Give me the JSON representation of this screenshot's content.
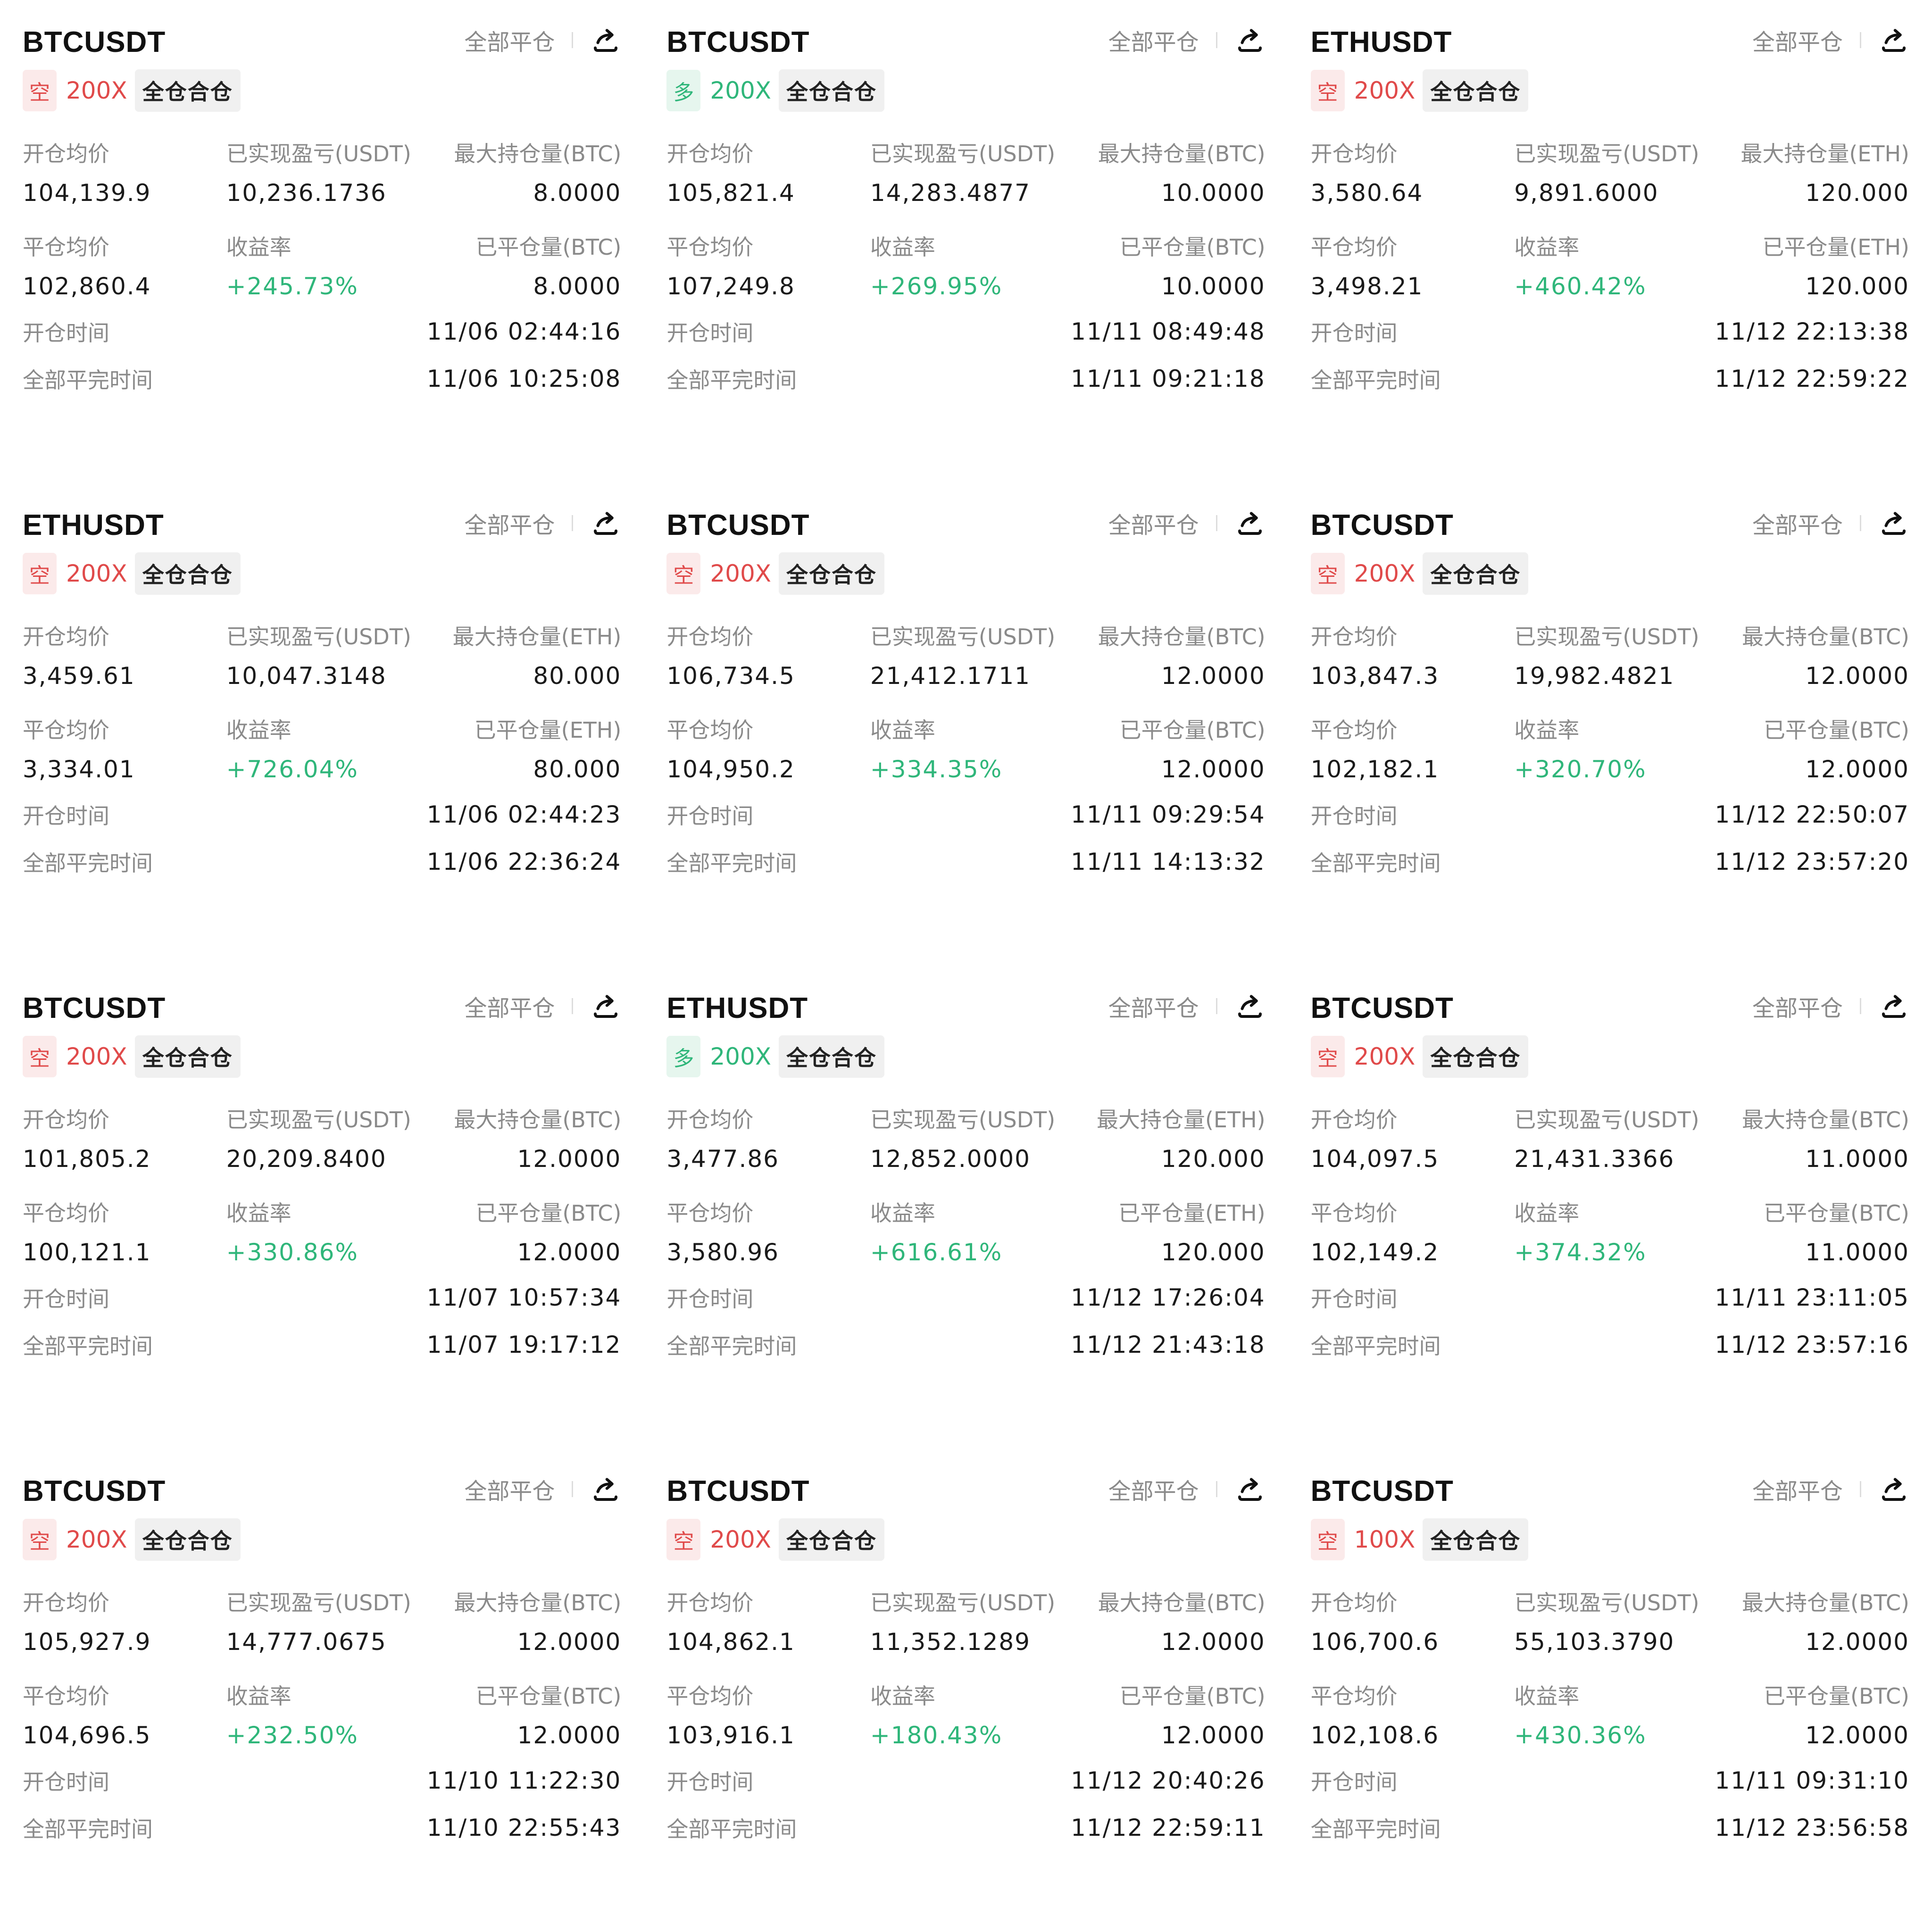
{
  "colors": {
    "short_red": "#e04a4a",
    "short_bg": "#fbeaea",
    "long_green": "#2fb67a",
    "long_bg": "#e6f6ee",
    "profit_green": "#2fb67a"
  },
  "cards": [
    {
      "symbol": "BTCUSDT",
      "close_all": "全部平仓",
      "side": "空",
      "side_type": "short",
      "leverage": "200X",
      "mode": "全仓合仓",
      "open_avg_label": "开仓均价",
      "open_avg": "104,139.9",
      "pnl_label": "已实现盈亏(USDT)",
      "pnl": "10,236.1736",
      "max_pos_label": "最大持仓量(BTC)",
      "max_pos": "8.0000",
      "close_avg_label": "平仓均价",
      "close_avg": "102,860.4",
      "roi_label": "收益率",
      "roi": "+245.73%",
      "closed_qty_label": "已平仓量(BTC)",
      "closed_qty": "8.0000",
      "open_time_label": "开仓时间",
      "open_time": "11/06 02:44:16",
      "close_time_label": "全部平完时间",
      "close_time": "11/06 10:25:08"
    },
    {
      "symbol": "BTCUSDT",
      "close_all": "全部平仓",
      "side": "多",
      "side_type": "long",
      "leverage": "200X",
      "mode": "全仓合仓",
      "open_avg_label": "开仓均价",
      "open_avg": "105,821.4",
      "pnl_label": "已实现盈亏(USDT)",
      "pnl": "14,283.4877",
      "max_pos_label": "最大持仓量(BTC)",
      "max_pos": "10.0000",
      "close_avg_label": "平仓均价",
      "close_avg": "107,249.8",
      "roi_label": "收益率",
      "roi": "+269.95%",
      "closed_qty_label": "已平仓量(BTC)",
      "closed_qty": "10.0000",
      "open_time_label": "开仓时间",
      "open_time": "11/11 08:49:48",
      "close_time_label": "全部平完时间",
      "close_time": "11/11 09:21:18"
    },
    {
      "symbol": "ETHUSDT",
      "close_all": "全部平仓",
      "side": "空",
      "side_type": "short",
      "leverage": "200X",
      "mode": "全仓合仓",
      "open_avg_label": "开仓均价",
      "open_avg": "3,580.64",
      "pnl_label": "已实现盈亏(USDT)",
      "pnl": "9,891.6000",
      "max_pos_label": "最大持仓量(ETH)",
      "max_pos": "120.000",
      "close_avg_label": "平仓均价",
      "close_avg": "3,498.21",
      "roi_label": "收益率",
      "roi": "+460.42%",
      "closed_qty_label": "已平仓量(ETH)",
      "closed_qty": "120.000",
      "open_time_label": "开仓时间",
      "open_time": "11/12 22:13:38",
      "close_time_label": "全部平完时间",
      "close_time": "11/12 22:59:22"
    },
    {
      "symbol": "ETHUSDT",
      "close_all": "全部平仓",
      "side": "空",
      "side_type": "short",
      "leverage": "200X",
      "mode": "全仓合仓",
      "open_avg_label": "开仓均价",
      "open_avg": "3,459.61",
      "pnl_label": "已实现盈亏(USDT)",
      "pnl": "10,047.3148",
      "max_pos_label": "最大持仓量(ETH)",
      "max_pos": "80.000",
      "close_avg_label": "平仓均价",
      "close_avg": "3,334.01",
      "roi_label": "收益率",
      "roi": "+726.04%",
      "closed_qty_label": "已平仓量(ETH)",
      "closed_qty": "80.000",
      "open_time_label": "开仓时间",
      "open_time": "11/06 02:44:23",
      "close_time_label": "全部平完时间",
      "close_time": "11/06 22:36:24"
    },
    {
      "symbol": "BTCUSDT",
      "close_all": "全部平仓",
      "side": "空",
      "side_type": "short",
      "leverage": "200X",
      "mode": "全仓合仓",
      "open_avg_label": "开仓均价",
      "open_avg": "106,734.5",
      "pnl_label": "已实现盈亏(USDT)",
      "pnl": "21,412.1711",
      "max_pos_label": "最大持仓量(BTC)",
      "max_pos": "12.0000",
      "close_avg_label": "平仓均价",
      "close_avg": "104,950.2",
      "roi_label": "收益率",
      "roi": "+334.35%",
      "closed_qty_label": "已平仓量(BTC)",
      "closed_qty": "12.0000",
      "open_time_label": "开仓时间",
      "open_time": "11/11 09:29:54",
      "close_time_label": "全部平完时间",
      "close_time": "11/11 14:13:32"
    },
    {
      "symbol": "BTCUSDT",
      "close_all": "全部平仓",
      "side": "空",
      "side_type": "short",
      "leverage": "200X",
      "mode": "全仓合仓",
      "open_avg_label": "开仓均价",
      "open_avg": "103,847.3",
      "pnl_label": "已实现盈亏(USDT)",
      "pnl": "19,982.4821",
      "max_pos_label": "最大持仓量(BTC)",
      "max_pos": "12.0000",
      "close_avg_label": "平仓均价",
      "close_avg": "102,182.1",
      "roi_label": "收益率",
      "roi": "+320.70%",
      "closed_qty_label": "已平仓量(BTC)",
      "closed_qty": "12.0000",
      "open_time_label": "开仓时间",
      "open_time": "11/12 22:50:07",
      "close_time_label": "全部平完时间",
      "close_time": "11/12 23:57:20"
    },
    {
      "symbol": "BTCUSDT",
      "close_all": "全部平仓",
      "side": "空",
      "side_type": "short",
      "leverage": "200X",
      "mode": "全仓合仓",
      "open_avg_label": "开仓均价",
      "open_avg": "101,805.2",
      "pnl_label": "已实现盈亏(USDT)",
      "pnl": "20,209.8400",
      "max_pos_label": "最大持仓量(BTC)",
      "max_pos": "12.0000",
      "close_avg_label": "平仓均价",
      "close_avg": "100,121.1",
      "roi_label": "收益率",
      "roi": "+330.86%",
      "closed_qty_label": "已平仓量(BTC)",
      "closed_qty": "12.0000",
      "open_time_label": "开仓时间",
      "open_time": "11/07 10:57:34",
      "close_time_label": "全部平完时间",
      "close_time": "11/07 19:17:12"
    },
    {
      "symbol": "ETHUSDT",
      "close_all": "全部平仓",
      "side": "多",
      "side_type": "long",
      "leverage": "200X",
      "mode": "全仓合仓",
      "open_avg_label": "开仓均价",
      "open_avg": "3,477.86",
      "pnl_label": "已实现盈亏(USDT)",
      "pnl": "12,852.0000",
      "max_pos_label": "最大持仓量(ETH)",
      "max_pos": "120.000",
      "close_avg_label": "平仓均价",
      "close_avg": "3,580.96",
      "roi_label": "收益率",
      "roi": "+616.61%",
      "closed_qty_label": "已平仓量(ETH)",
      "closed_qty": "120.000",
      "open_time_label": "开仓时间",
      "open_time": "11/12 17:26:04",
      "close_time_label": "全部平完时间",
      "close_time": "11/12 21:43:18"
    },
    {
      "symbol": "BTCUSDT",
      "close_all": "全部平仓",
      "side": "空",
      "side_type": "short",
      "leverage": "200X",
      "mode": "全仓合仓",
      "open_avg_label": "开仓均价",
      "open_avg": "104,097.5",
      "pnl_label": "已实现盈亏(USDT)",
      "pnl": "21,431.3366",
      "max_pos_label": "最大持仓量(BTC)",
      "max_pos": "11.0000",
      "close_avg_label": "平仓均价",
      "close_avg": "102,149.2",
      "roi_label": "收益率",
      "roi": "+374.32%",
      "closed_qty_label": "已平仓量(BTC)",
      "closed_qty": "11.0000",
      "open_time_label": "开仓时间",
      "open_time": "11/11 23:11:05",
      "close_time_label": "全部平完时间",
      "close_time": "11/12 23:57:16"
    },
    {
      "symbol": "BTCUSDT",
      "close_all": "全部平仓",
      "side": "空",
      "side_type": "short",
      "leverage": "200X",
      "mode": "全仓合仓",
      "open_avg_label": "开仓均价",
      "open_avg": "105,927.9",
      "pnl_label": "已实现盈亏(USDT)",
      "pnl": "14,777.0675",
      "max_pos_label": "最大持仓量(BTC)",
      "max_pos": "12.0000",
      "close_avg_label": "平仓均价",
      "close_avg": "104,696.5",
      "roi_label": "收益率",
      "roi": "+232.50%",
      "closed_qty_label": "已平仓量(BTC)",
      "closed_qty": "12.0000",
      "open_time_label": "开仓时间",
      "open_time": "11/10 11:22:30",
      "close_time_label": "全部平完时间",
      "close_time": "11/10 22:55:43"
    },
    {
      "symbol": "BTCUSDT",
      "close_all": "全部平仓",
      "side": "空",
      "side_type": "short",
      "leverage": "200X",
      "mode": "全仓合仓",
      "open_avg_label": "开仓均价",
      "open_avg": "104,862.1",
      "pnl_label": "已实现盈亏(USDT)",
      "pnl": "11,352.1289",
      "max_pos_label": "最大持仓量(BTC)",
      "max_pos": "12.0000",
      "close_avg_label": "平仓均价",
      "close_avg": "103,916.1",
      "roi_label": "收益率",
      "roi": "+180.43%",
      "closed_qty_label": "已平仓量(BTC)",
      "closed_qty": "12.0000",
      "open_time_label": "开仓时间",
      "open_time": "11/12 20:40:26",
      "close_time_label": "全部平完时间",
      "close_time": "11/12 22:59:11"
    },
    {
      "symbol": "BTCUSDT",
      "close_all": "全部平仓",
      "side": "空",
      "side_type": "short",
      "leverage": "100X",
      "mode": "全仓合仓",
      "open_avg_label": "开仓均价",
      "open_avg": "106,700.6",
      "pnl_label": "已实现盈亏(USDT)",
      "pnl": "55,103.3790",
      "max_pos_label": "最大持仓量(BTC)",
      "max_pos": "12.0000",
      "close_avg_label": "平仓均价",
      "close_avg": "102,108.6",
      "roi_label": "收益率",
      "roi": "+430.36%",
      "closed_qty_label": "已平仓量(BTC)",
      "closed_qty": "12.0000",
      "open_time_label": "开仓时间",
      "open_time": "11/11 09:31:10",
      "close_time_label": "全部平完时间",
      "close_time": "11/12 23:56:58"
    }
  ]
}
